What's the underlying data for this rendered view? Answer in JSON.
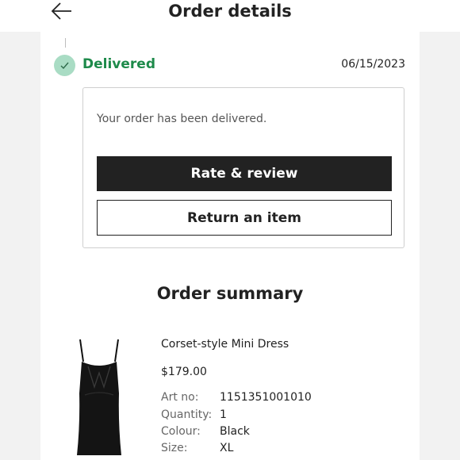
{
  "header": {
    "title": "Order details"
  },
  "status": {
    "label": "Delivered",
    "date": "06/15/2023",
    "color": "#1d8a4a",
    "icon": "check-icon"
  },
  "delivery": {
    "message": "Your order has been delivered.",
    "rate_label": "Rate & review",
    "return_label": "Return an item"
  },
  "summary": {
    "title": "Order summary",
    "product": {
      "name": "Corset-style Mini Dress",
      "price": "$179.00",
      "details": [
        {
          "label": "Art no:",
          "value": "1151351001010"
        },
        {
          "label": "Quantity:",
          "value": "1"
        },
        {
          "label": "Colour:",
          "value": "Black"
        },
        {
          "label": "Size:",
          "value": "XL"
        }
      ]
    }
  }
}
